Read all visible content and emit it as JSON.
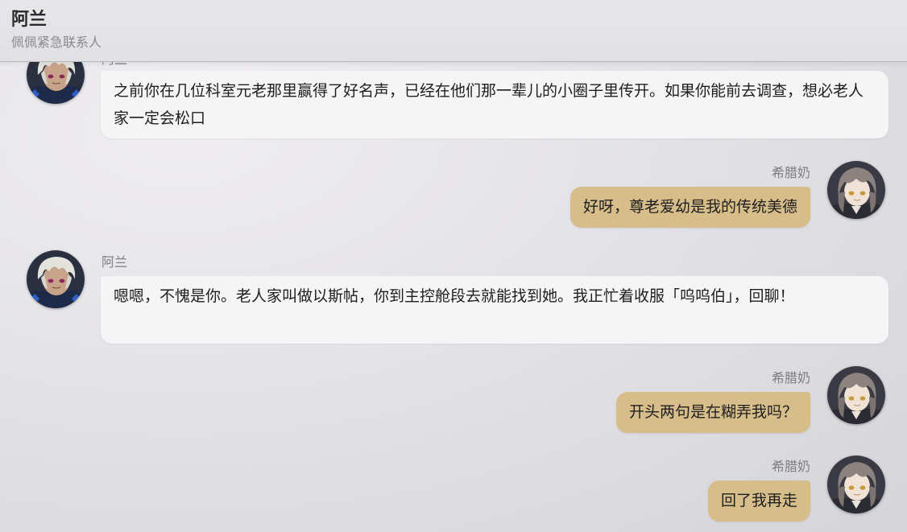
{
  "header": {
    "contact_name": "阿兰",
    "contact_subtitle": "佩佩紧急联系人"
  },
  "messages": [
    {
      "sender": "阿兰",
      "direction": "incoming",
      "text": "之前你在几位科室元老那里赢得了好名声，已经在他们那一辈儿的小圈子里传开。如果你能前去调查，想必老人家一定会松口"
    },
    {
      "sender": "希腊奶",
      "direction": "outgoing",
      "text": "好呀，尊老爱幼是我的传统美德"
    },
    {
      "sender": "阿兰",
      "direction": "incoming",
      "text": "嗯嗯，不愧是你。老人家叫做以斯帖，你到主控舱段去就能找到她。我正忙着收服「呜呜伯」，回聊！"
    },
    {
      "sender": "希腊奶",
      "direction": "outgoing",
      "text": "开头两句是在糊弄我吗？"
    },
    {
      "sender": "希腊奶",
      "direction": "outgoing",
      "text": "回了我再走"
    }
  ],
  "colors": {
    "incoming_bubble": "#f5f5f6",
    "outgoing_bubble": "#d6bd8a",
    "sender_name": "#7d7d82"
  },
  "avatars": {
    "incoming": "white-haired-character-avatar",
    "outgoing": "brown-haired-character-avatar"
  }
}
